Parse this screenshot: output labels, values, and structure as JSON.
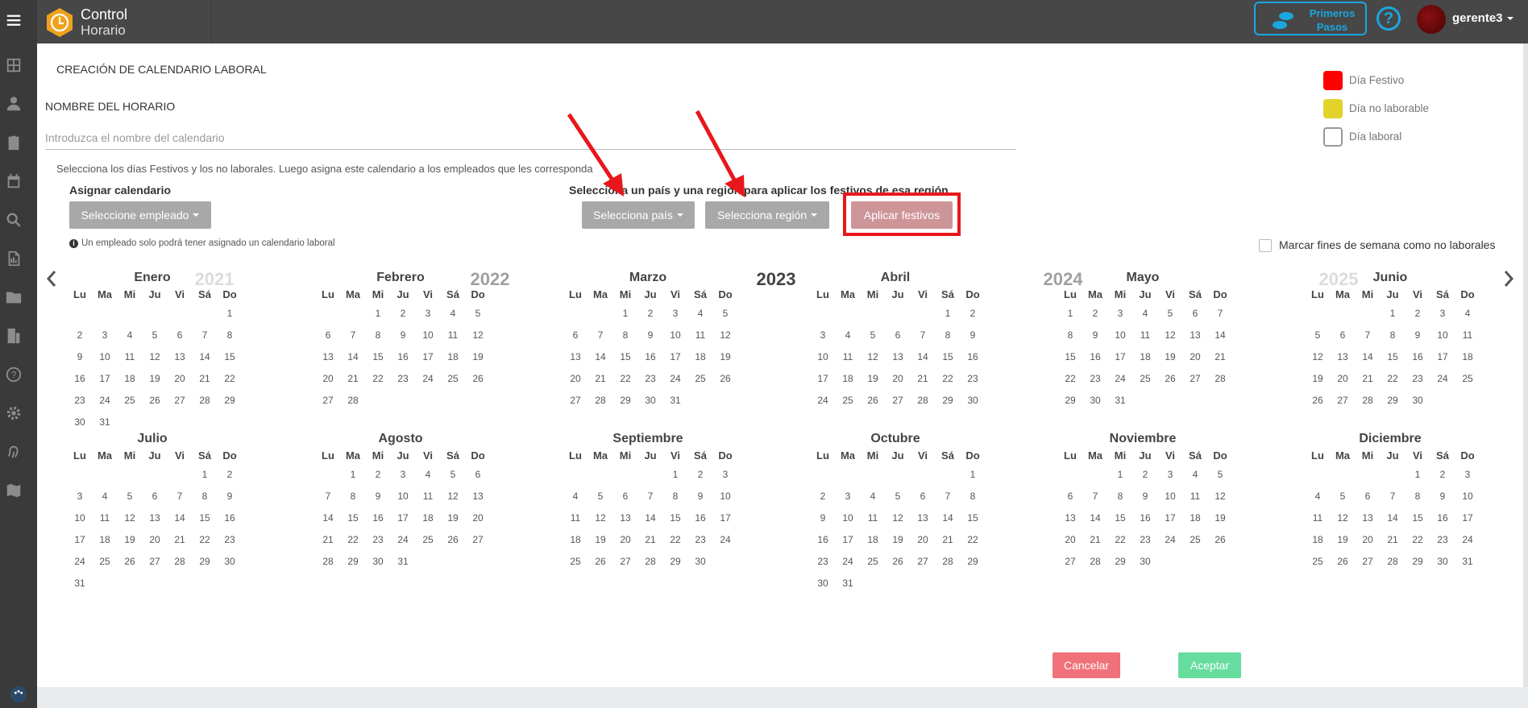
{
  "header": {
    "logo_line1": "Control",
    "logo_line2": "Horario",
    "primeros_line1": "Primeros",
    "primeros_line2": "Pasos",
    "help": "?",
    "user": "gerente3"
  },
  "page": {
    "title": "CREACIÓN DE CALENDARIO LABORAL",
    "name_label": "NOMBRE DEL HORARIO",
    "name_placeholder": "Introduzca el nombre del calendario",
    "help_text": "Selecciona los días Festivos y los no laborales. Luego asigna este calendario a los empleados que les corresponda",
    "assign_label": "Asignar calendario",
    "select_employee": "Seleccione empleado",
    "assign_note": "Un empleado solo podrá tener asignado un calendario laboral",
    "country_label": "Selecciona un país y una región para aplicar los festivos de esa región",
    "select_country": "Selecciona país",
    "select_region": "Selecciona región",
    "apply": "Aplicar festivos",
    "weekend": "Marcar fines de semana como no laborales",
    "cancel": "Cancelar",
    "accept": "Aceptar"
  },
  "legend": [
    {
      "label": "Día Festivo",
      "color": "#ff0000"
    },
    {
      "label": "Día no laborable",
      "color": "#e3d22a"
    },
    {
      "label": "Día laboral",
      "color": "#ffffff"
    }
  ],
  "years": [
    {
      "label": "2021",
      "color": "#dcdcdc"
    },
    {
      "label": "2022",
      "color": "#a0a0a0"
    },
    {
      "label": "2023",
      "color": "#444444"
    },
    {
      "label": "2024",
      "color": "#a0a0a0"
    },
    {
      "label": "2025",
      "color": "#dcdcdc"
    }
  ],
  "weekdays": [
    "Lu",
    "Ma",
    "Mi",
    "Ju",
    "Vi",
    "Sá",
    "Do"
  ],
  "calendar": {
    "year": "2023",
    "months": [
      {
        "name": "Enero",
        "offset": 6,
        "days": 31
      },
      {
        "name": "Febrero",
        "offset": 2,
        "days": 28
      },
      {
        "name": "Marzo",
        "offset": 2,
        "days": 31
      },
      {
        "name": "Abril",
        "offset": 5,
        "days": 30
      },
      {
        "name": "Mayo",
        "offset": 0,
        "days": 31
      },
      {
        "name": "Junio",
        "offset": 3,
        "days": 30
      },
      {
        "name": "Julio",
        "offset": 5,
        "days": 31
      },
      {
        "name": "Agosto",
        "offset": 1,
        "days": 31
      },
      {
        "name": "Septiembre",
        "offset": 4,
        "days": 30
      },
      {
        "name": "Octubre",
        "offset": 6,
        "days": 31
      },
      {
        "name": "Noviembre",
        "offset": 2,
        "days": 30
      },
      {
        "name": "Diciembre",
        "offset": 4,
        "days": 31
      }
    ]
  }
}
